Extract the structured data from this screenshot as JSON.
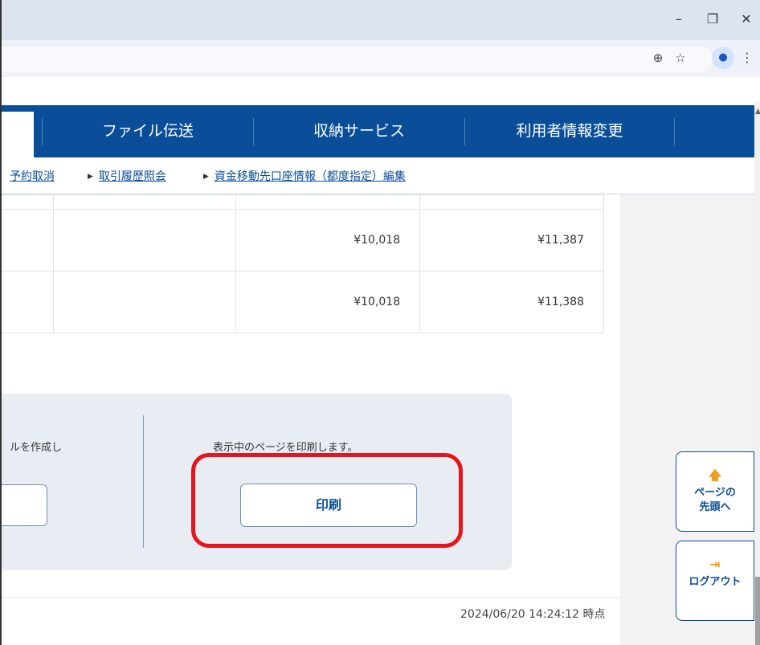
{
  "window": {
    "minimize_glyph": "–",
    "restore_glyph": "❐",
    "close_glyph": "✕",
    "zoom_icon": "⊕",
    "star_icon": "☆",
    "profile_icon": "●",
    "menu_icon": "⋮"
  },
  "nav": {
    "tabs": [
      {
        "label": "ファイル伝送"
      },
      {
        "label": "収納サービス"
      },
      {
        "label": "利用者情報変更"
      }
    ]
  },
  "sublinks": [
    {
      "label": "予約取消"
    },
    {
      "label": "取引履歴照会"
    },
    {
      "label": "資金移動先口座情報（都度指定）編集"
    }
  ],
  "table": {
    "rows": [
      {
        "col2": "¥10,018",
        "col3": "¥11,387"
      },
      {
        "col2": "¥10,018",
        "col3": "¥11,388"
      }
    ]
  },
  "actions": {
    "left_desc": "ルを作成し",
    "right_desc": "表示中のページを印刷します。",
    "print_label": "印刷"
  },
  "footer": {
    "timestamp": "2024/06/20 14:24:12 時点"
  },
  "side_buttons": {
    "top_icon": "🡅",
    "top_line1": "ページの",
    "top_line2": "先頭へ",
    "logout_icon": "⇥",
    "logout_label": "ログアウト"
  },
  "colors": {
    "brand_blue": "#0a4e9a",
    "highlight_red": "#e8141c",
    "accent_orange": "#f0a020"
  }
}
